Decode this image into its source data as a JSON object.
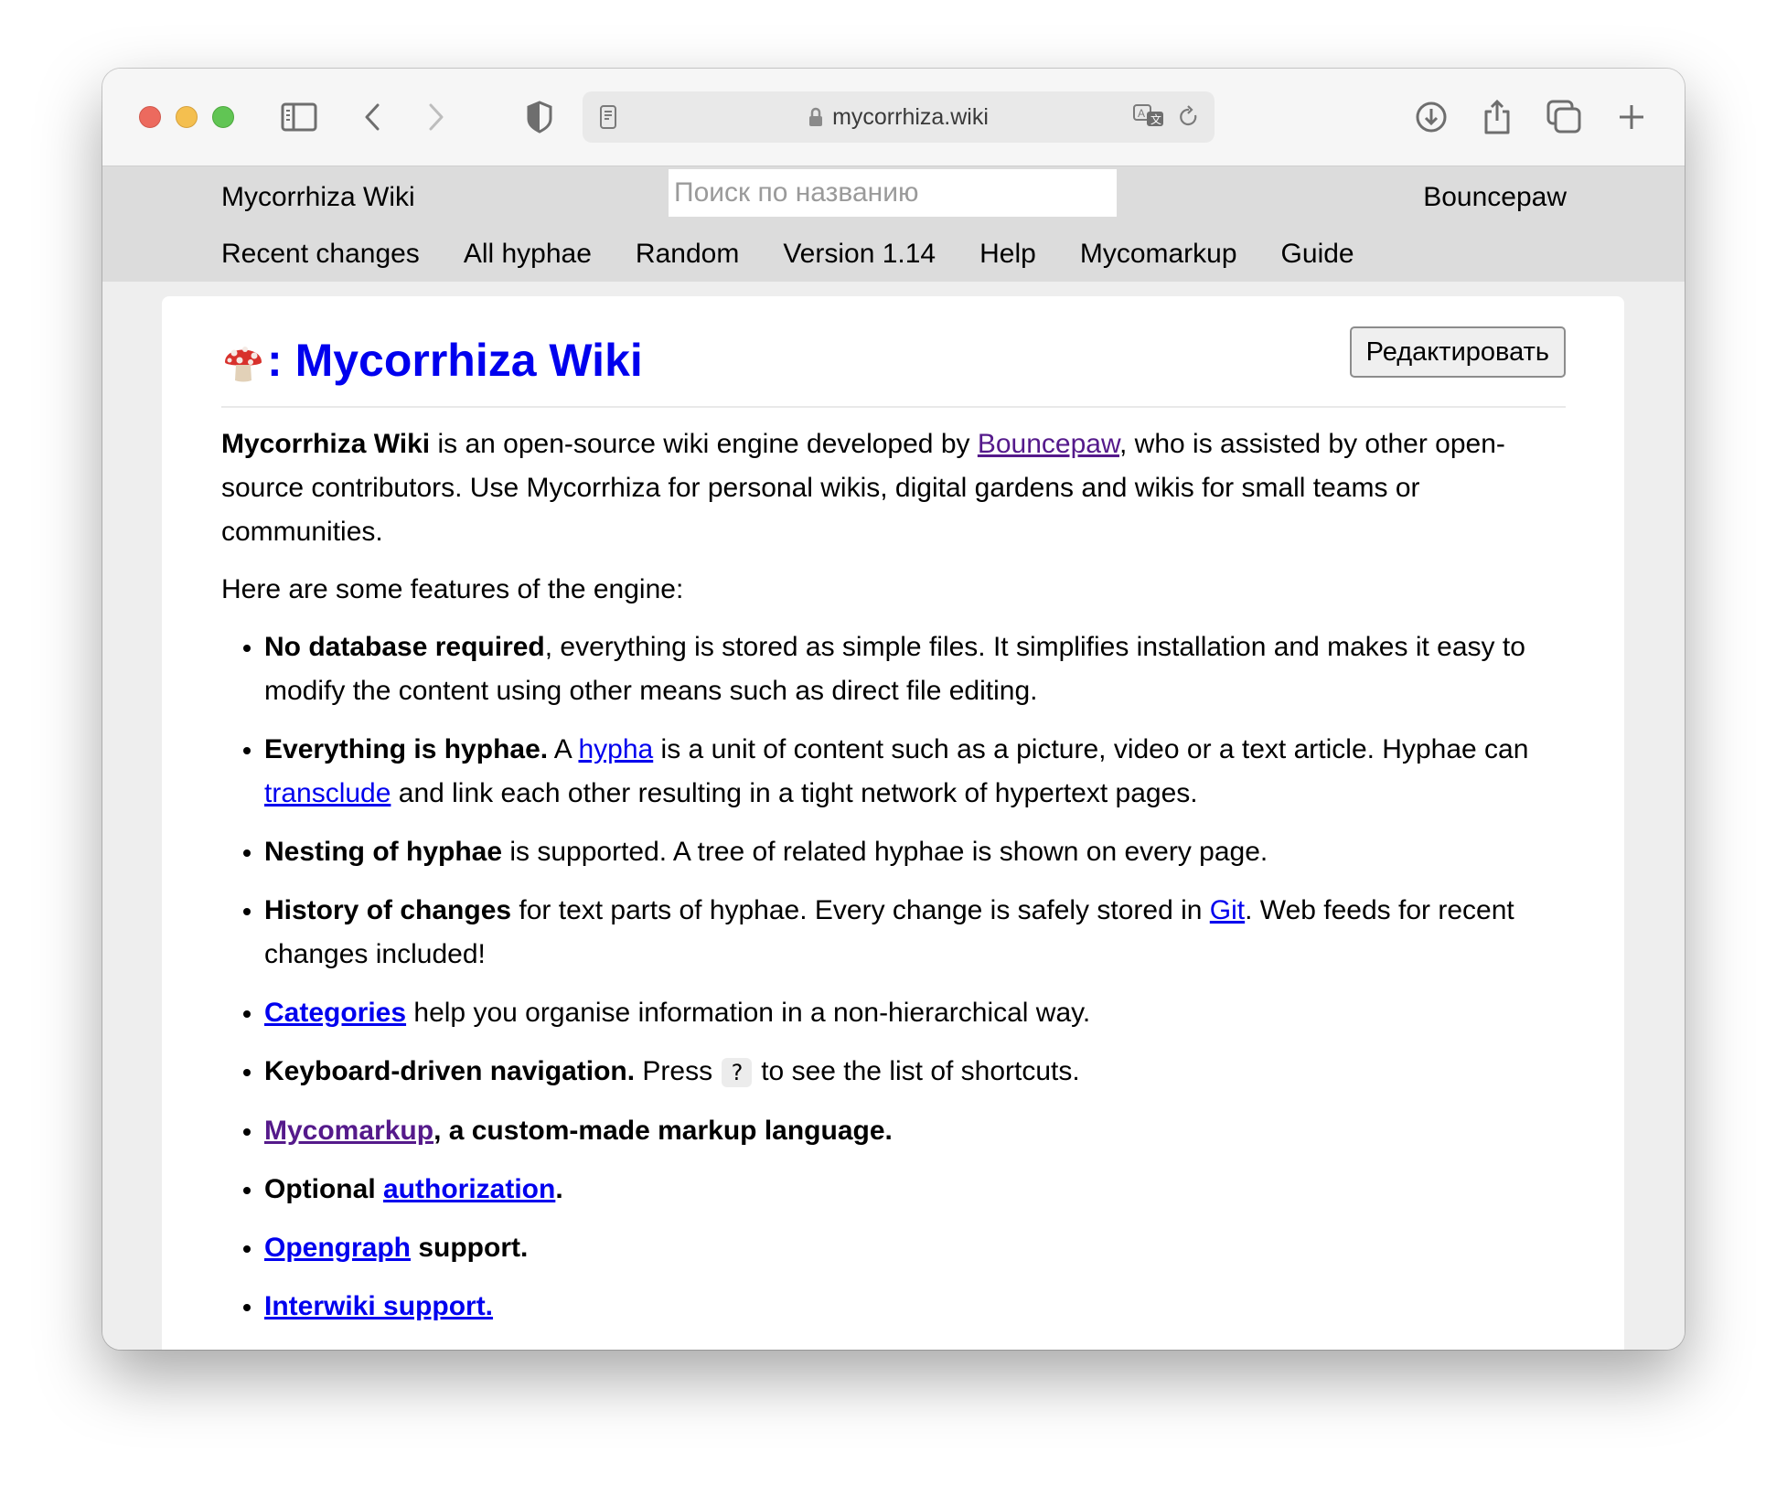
{
  "browser": {
    "url": "mycorrhiza.wiki",
    "icons": [
      "sidebar-icon",
      "back-icon",
      "forward-icon",
      "shield-icon",
      "reader-icon",
      "lock-icon",
      "translate-icon",
      "reload-icon",
      "download-icon",
      "share-icon",
      "tabs-icon",
      "new-tab-icon"
    ]
  },
  "header": {
    "site_title": "Mycorrhiza Wiki",
    "search_placeholder": "Поиск по названию",
    "search_value": "",
    "user": "Bouncepaw",
    "nav": [
      "Recent changes",
      "All hyphae",
      "Random",
      "Version 1.14",
      "Help",
      "Mycomarkup",
      "Guide"
    ]
  },
  "page": {
    "title_emoji": "🍄",
    "title_sep": ":",
    "title": "Mycorrhiza Wiki",
    "edit_button": "Редактировать",
    "intro": {
      "bold": "Mycorrhiza Wiki",
      "t1": " is an open-source wiki engine developed by ",
      "link": "Bouncepaw",
      "t2": ", who is assisted by other open-source contributors. Use Mycorrhiza for personal wikis, digital gardens and wikis for small teams or communities."
    },
    "features_intro": "Here are some features of the engine:",
    "features": {
      "f1": {
        "bold": "No database required",
        "text": ", everything is stored as simple files. It simplifies installation and makes it easy to modify the content using other means such as direct file editing."
      },
      "f2": {
        "bold": "Everything is hyphae.",
        "t1": " A ",
        "link1": "hypha",
        "t2": " is a unit of content such as a picture, video or a text article. Hyphae can ",
        "link2": "transclude",
        "t3": " and link each other resulting in a tight network of hypertext pages."
      },
      "f3": {
        "bold": "Nesting of hyphae",
        "text": " is supported. A tree of related hyphae is shown on every page."
      },
      "f4": {
        "bold": "History of changes",
        "t1": " for text parts of hyphae. Every change is safely stored in ",
        "link": "Git",
        "t2": ". Web feeds for recent changes included!"
      },
      "f5": {
        "link": "Categories",
        "text": " help you organise information in a non-hierarchical way."
      },
      "f6": {
        "bold": "Keyboard-driven navigation.",
        "t1": " Press ",
        "kbd": "?",
        "t2": " to see the list of shortcuts."
      },
      "f7": {
        "link": "Mycomarkup",
        "bold": ", a custom-made markup language."
      },
      "f8": {
        "bold": "Optional ",
        "link": "authorization",
        "tail": "."
      },
      "f9": {
        "link": "Opengraph",
        "bold": " support."
      },
      "f10": {
        "link": "Interwiki support."
      }
    }
  },
  "colors": {
    "link": "#0000ee",
    "visited": "#551a8b",
    "header_bg": "#dcdcdc",
    "content_bg": "#eeeeee"
  }
}
